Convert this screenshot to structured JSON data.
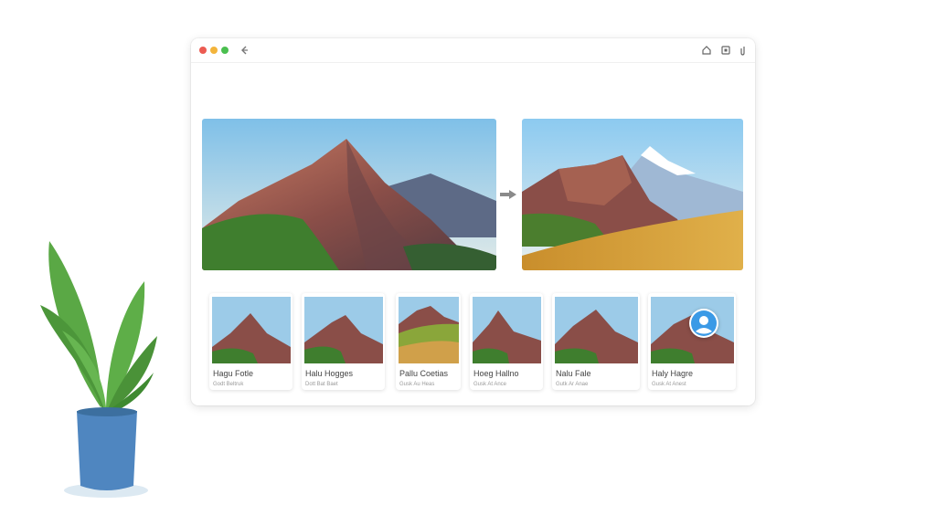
{
  "window": {
    "controls": [
      "close",
      "minimize",
      "maximize"
    ],
    "toolbar_icons": [
      "back-arrow-icon",
      "home-icon",
      "screen-icon",
      "paperclip-icon"
    ]
  },
  "comparison": {
    "left_image": "rocky mountain peak with green hillside",
    "right_image": "mountain with snow-capped peak and golden grass",
    "arrow_icon": "right-arrow-icon"
  },
  "thumbnails": [
    {
      "title": "Hagu Fotle",
      "subtitle": "Godt Beltruk"
    },
    {
      "title": "Halu Hogges",
      "subtitle": "Dott Bat Baet"
    },
    {
      "title": "Pallu Coetias",
      "subtitle": "Gusk Au Heas"
    },
    {
      "title": "Hoeg Hallno",
      "subtitle": "Gusk At Ance"
    },
    {
      "title": "Nalu Fale",
      "subtitle": "Gutk Ar Anae"
    },
    {
      "title": "Haly Hagre",
      "subtitle": "Gusk At Anest"
    }
  ],
  "colors": {
    "sky_top": "#7fc0e8",
    "sky_bottom": "#dbe9ee",
    "rock": "#8a4e48",
    "grass": "#3f7e2e",
    "golden": "#d6a23a",
    "avatar_blue": "#3b9ae6",
    "pot": "#4f86c0",
    "leaf": "#4f9e3c"
  }
}
